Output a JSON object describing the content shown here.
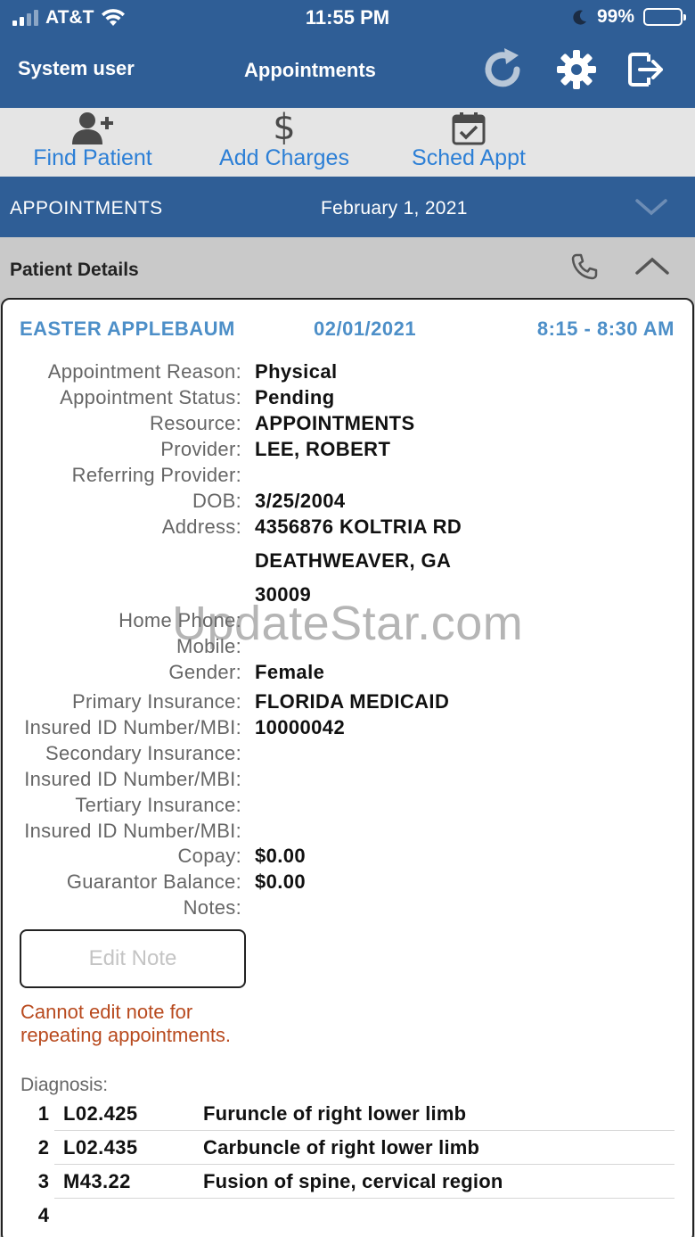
{
  "status_bar": {
    "carrier": "AT&T",
    "time": "11:55 PM",
    "battery": "99%"
  },
  "nav": {
    "user": "System user",
    "title": "Appointments"
  },
  "toolbar": [
    {
      "label": "Find Patient",
      "icon": "add-user-icon"
    },
    {
      "label": "Add Charges",
      "icon": "dollar-icon"
    },
    {
      "label": "Sched Appt",
      "icon": "calendar-check-icon"
    }
  ],
  "appointments_bar": {
    "label": "APPOINTMENTS",
    "date": "February 1, 2021"
  },
  "patient_details": {
    "title": "Patient Details"
  },
  "appointment": {
    "patient_name": "EASTER APPLEBAUM",
    "date": "02/01/2021",
    "time": "8:15 - 8:30 AM",
    "fields": {
      "reason_label": "Appointment Reason:",
      "reason": "Physical",
      "status_label": "Appointment Status:",
      "status": "Pending",
      "resource_label": "Resource:",
      "resource": "APPOINTMENTS",
      "provider_label": "Provider:",
      "provider": "LEE, ROBERT",
      "referring_label": "Referring Provider:",
      "dob_label": "DOB:",
      "dob": "3/25/2004",
      "address_label": "Address:",
      "address_line1": "4356876 KOLTRIA RD",
      "address_line2": "DEATHWEAVER, GA",
      "address_line3": "30009",
      "home_phone_label": "Home Phone:",
      "mobile_label": "Mobile:",
      "gender_label": "Gender:",
      "gender": "Female",
      "primary_ins_label": "Primary Insurance:",
      "primary_ins": "FLORIDA MEDICAID",
      "insured_id_label": "Insured ID Number/MBI:",
      "insured_id": "10000042",
      "secondary_ins_label": "Secondary Insurance:",
      "insured_id2_label": "Insured ID Number/MBI:",
      "tertiary_ins_label": "Tertiary Insurance:",
      "insured_id3_label": "Insured ID Number/MBI:",
      "copay_label": "Copay:",
      "copay": "$0.00",
      "guarantor_label": "Guarantor Balance:",
      "guarantor": "$0.00",
      "notes_label": "Notes:"
    },
    "edit_note_label": "Edit Note",
    "edit_note_warning": "Cannot edit note for repeating appointments.",
    "diagnosis_label": "Diagnosis:",
    "diagnoses": [
      {
        "num": "1",
        "code": "L02.425",
        "desc": "Furuncle of right lower limb"
      },
      {
        "num": "2",
        "code": "L02.435",
        "desc": "Carbuncle of right lower limb"
      },
      {
        "num": "3",
        "code": "M43.22",
        "desc": "Fusion of spine, cervical region"
      },
      {
        "num": "4",
        "code": "",
        "desc": ""
      }
    ]
  },
  "watermark": "UpdateStar.com",
  "colors": {
    "header_blue": "#2f5e96",
    "link_blue": "#2c7fd6",
    "warning": "#b84a1e"
  }
}
